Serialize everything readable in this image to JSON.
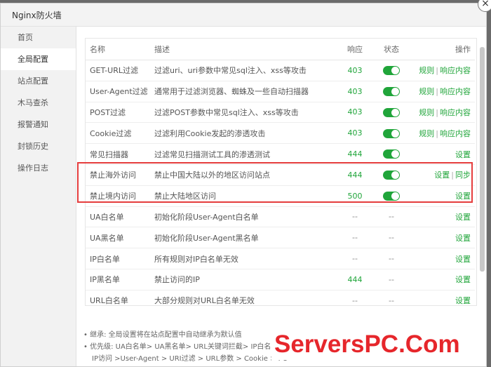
{
  "window": {
    "title": "Nginx防火墙",
    "close_glyph": "×"
  },
  "sidebar": {
    "items": [
      {
        "label": "首页",
        "active": false
      },
      {
        "label": "全局配置",
        "active": true
      },
      {
        "label": "站点配置",
        "active": false
      },
      {
        "label": "木马查杀",
        "active": false
      },
      {
        "label": "报警通知",
        "active": false
      },
      {
        "label": "封锁历史",
        "active": false
      },
      {
        "label": "操作日志",
        "active": false
      }
    ]
  },
  "table": {
    "headers": {
      "name": "名称",
      "desc": "描述",
      "resp": "响应",
      "status": "状态",
      "ops": "操作"
    },
    "rows": [
      {
        "name": "GET-URL过滤",
        "desc": "过滤uri、uri参数中常见sql注入、xss等攻击",
        "resp": "403",
        "status": "on",
        "ops": [
          "规则",
          "响应内容"
        ]
      },
      {
        "name": "User-Agent过滤",
        "desc": "通常用于过滤浏览器、蜘蛛及一些自动扫描器",
        "resp": "403",
        "status": "on",
        "ops": [
          "规则",
          "响应内容"
        ]
      },
      {
        "name": "POST过滤",
        "desc": "过滤POST参数中常见sql注入、xss等攻击",
        "resp": "403",
        "status": "on",
        "ops": [
          "规则",
          "响应内容"
        ]
      },
      {
        "name": "Cookie过滤",
        "desc": "过滤利用Cookie发起的渗透攻击",
        "resp": "403",
        "status": "on",
        "ops": [
          "规则",
          "响应内容"
        ]
      },
      {
        "name": "常见扫描器",
        "desc": "过滤常见扫描测试工具的渗透测试",
        "resp": "444",
        "status": "on",
        "ops": [
          "设置"
        ]
      },
      {
        "name": "禁止海外访问",
        "desc": "禁止中国大陆以外的地区访问站点",
        "resp": "444",
        "status": "on",
        "ops": [
          "设置",
          "同步"
        ]
      },
      {
        "name": "禁止境内访问",
        "desc": "禁止大陆地区访问",
        "resp": "500",
        "status": "on",
        "ops": [
          "设置"
        ]
      },
      {
        "name": "UA白名单",
        "desc": "初始化阶段User-Agent白名单",
        "resp": "--",
        "status": "--",
        "ops": [
          "设置"
        ]
      },
      {
        "name": "UA黑名单",
        "desc": "初始化阶段User-Agent黑名单",
        "resp": "--",
        "status": "--",
        "ops": [
          "设置"
        ]
      },
      {
        "name": "IP白名单",
        "desc": "所有规则对IP白名单无效",
        "resp": "--",
        "status": "--",
        "ops": [
          "设置"
        ]
      },
      {
        "name": "IP黑名单",
        "desc": "禁止访问的IP",
        "resp": "444",
        "status": "--",
        "ops": [
          "设置"
        ]
      },
      {
        "name": "URL白名单",
        "desc": "大部分规则对URL白名单无效",
        "resp": "--",
        "status": "--",
        "ops": [
          "设置"
        ]
      }
    ]
  },
  "notes": [
    "• 继承: 全局设置将在站点配置中自动继承为默认值",
    "• 优先级: UA白名单> UA黑名单> URL关键词拦截> IP白名单 >",
    "IP访问 >User-Agent > URI过滤 > URL参数 > Cookie > PO"
  ],
  "watermark": "ServersPC.Com",
  "colors": {
    "accent": "#20a53a",
    "highlight": "#e53d3d",
    "watermark": "#e6262b"
  }
}
